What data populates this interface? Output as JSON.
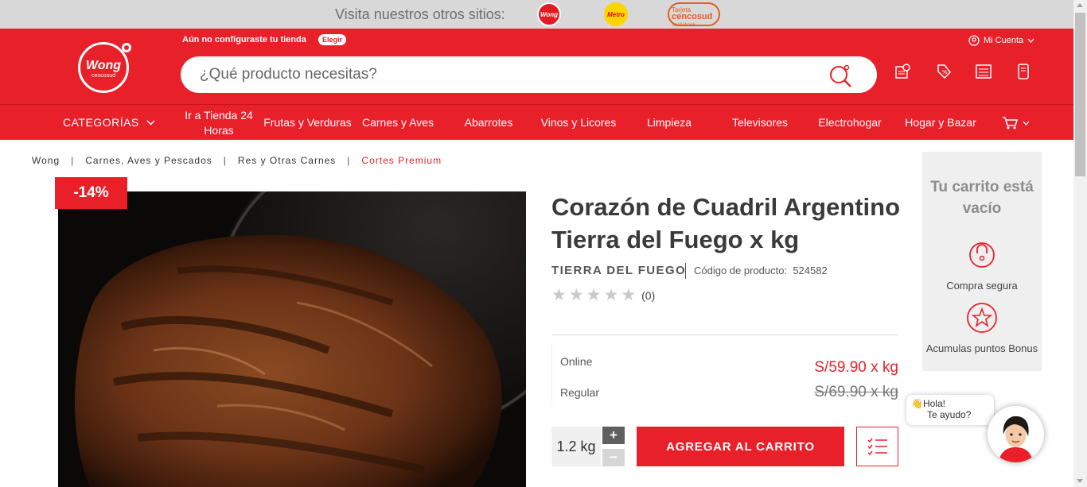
{
  "top_strip": {
    "visit_text": "Visita nuestros otros sitios:",
    "sites": [
      {
        "name": "Wong",
        "icon": "wong-site-logo"
      },
      {
        "name": "Metro",
        "icon": "metro-site-logo"
      },
      {
        "name": "Tarjeta Cencosud",
        "icon": "tarjeta-cencosud-logo",
        "line1": "Tarjeta",
        "line2": "cencosud",
        "line3": "Scotiabank"
      }
    ]
  },
  "header": {
    "logo_text": "Wong",
    "logo_sub": "cencosud",
    "store_message": "Aún no configuraste tu tienda",
    "store_button": "Elegir",
    "search_placeholder": "¿Qué producto necesitas?",
    "account_label": "Mi Cuenta",
    "icons": [
      "price-check-icon",
      "offers-tag-icon",
      "shopping-list-icon",
      "orders-phone-icon"
    ],
    "accent_color": "#e8202a"
  },
  "nav": {
    "categories_label": "CATEGORÍAS",
    "items": [
      "Ir a Tienda 24 Horas",
      "Frutas y Verduras",
      "Carnes y Aves",
      "Abarrotes",
      "Vinos y Licores",
      "Limpieza",
      "Televisores",
      "Electrohogar",
      "Hogar y Bazar"
    ]
  },
  "breadcrumb": {
    "items": [
      "Wong",
      "Carnes, Aves y Pescados",
      "Res y Otras Carnes",
      "Cortes Premium"
    ],
    "separator": "|"
  },
  "product": {
    "discount": "-14%",
    "title": "Corazón de Cuadril Argentino Tierra del Fuego x kg",
    "brand": "TIERRA DEL FUEGO",
    "sku_label": "Código de producto:",
    "sku": "524582",
    "rating_count": "(0)",
    "rating_stars": 0,
    "online_label": "Online",
    "online_price": "S/59.90 x kg",
    "regular_label": "Regular",
    "regular_price": "S/69.90 x kg",
    "quantity": "1.2 kg",
    "plus": "+",
    "minus": "−",
    "add_to_cart": "AGREGAR AL CARRITO"
  },
  "cart": {
    "empty_text": "Tu carrito está vacío",
    "secure_label": "Compra segura",
    "bonus_label": "Acumulas puntos Bonus"
  },
  "chat": {
    "line1": "Hola!",
    "line2": "Te ayudo?"
  }
}
